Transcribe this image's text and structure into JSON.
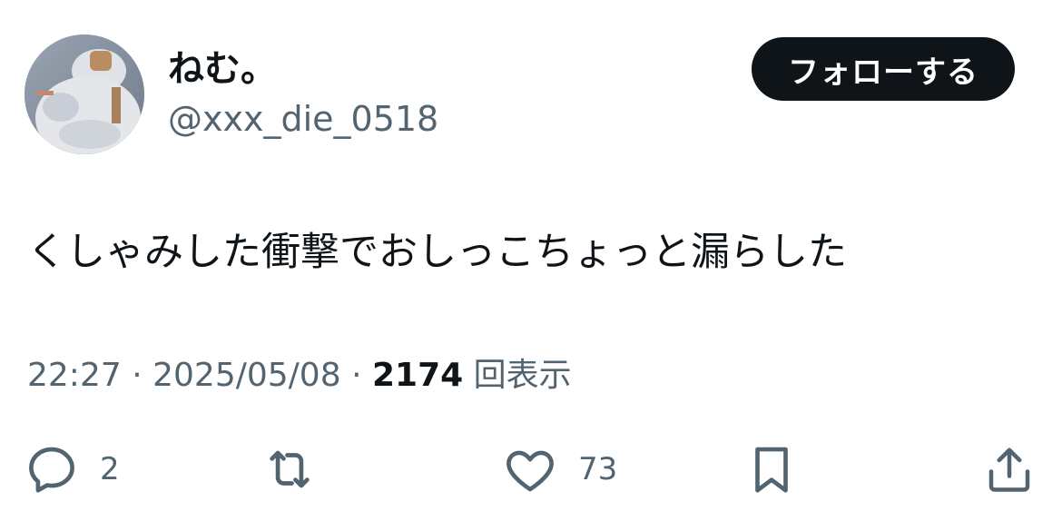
{
  "user": {
    "display_name": "ねむ。",
    "handle": "@xxx_die_0518"
  },
  "follow_button": {
    "label": "フォローする"
  },
  "tweet": {
    "text": "くしゃみした衝撃でおしっこちょっと漏らした",
    "time": "22:27",
    "separator": "·",
    "date": "2025/05/08",
    "views_count": "2174",
    "views_label": "回表示"
  },
  "actions": {
    "reply_count": "2",
    "like_count": "73"
  },
  "icons": {
    "reply": "speech-bubble-icon",
    "retweet": "retweet-arrows-icon",
    "like": "heart-icon",
    "bookmark": "bookmark-icon",
    "share": "share-upload-icon"
  },
  "colors": {
    "text": "#0f1419",
    "secondary": "#536471",
    "follow_bg": "#0f1419",
    "follow_text": "#ffffff"
  }
}
